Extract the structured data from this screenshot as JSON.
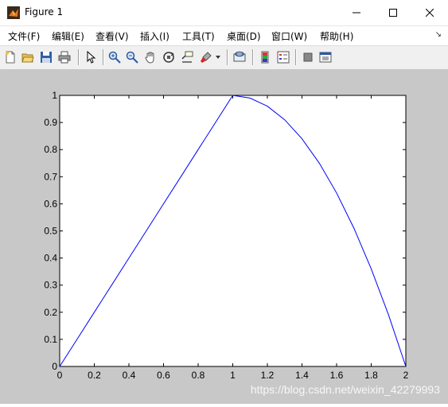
{
  "window": {
    "title": "Figure 1"
  },
  "menu": [
    "文件(F)",
    "编辑(E)",
    "查看(V)",
    "插入(I)",
    "工具(T)",
    "桌面(D)",
    "窗口(W)",
    "帮助(H)"
  ],
  "menu_overflow_icon": "chevron-double-down-icon",
  "toolbar": {
    "buttons": [
      "new-figure-icon",
      "open-file-icon",
      "save-icon",
      "print-icon",
      "edit-plot-arrow-icon",
      "zoom-in-icon",
      "zoom-out-icon",
      "pan-hand-icon",
      "rotate-3d-icon",
      "data-cursor-icon",
      "brush-icon",
      "insert-colorbar-icon",
      "insert-legend-icon",
      "hide-plot-tools-icon",
      "show-plot-tools-icon",
      "link-plot-icon"
    ]
  },
  "watermark": "https://blog.csdn.net/weixin_42279993",
  "colors": {
    "line": "#0000ff",
    "figure_bg": "#c8c8c8",
    "axes_bg": "#ffffff"
  },
  "chart_data": {
    "type": "line",
    "title": "",
    "xlabel": "",
    "ylabel": "",
    "xlim": [
      0,
      2
    ],
    "ylim": [
      0,
      1
    ],
    "xticks": [
      "0",
      "0.2",
      "0.4",
      "0.6",
      "0.8",
      "1",
      "1.2",
      "1.4",
      "1.6",
      "1.8",
      "2"
    ],
    "yticks": [
      "0",
      "0.1",
      "0.2",
      "0.3",
      "0.4",
      "0.5",
      "0.6",
      "0.7",
      "0.8",
      "0.9",
      "1"
    ],
    "grid": false,
    "series": [
      {
        "x": [
          0,
          0.1,
          0.2,
          0.3,
          0.4,
          0.5,
          0.6,
          0.7,
          0.8,
          0.9,
          1.0,
          1.1,
          1.2,
          1.3,
          1.4,
          1.5,
          1.6,
          1.7,
          1.8,
          1.9,
          2.0
        ],
        "y": [
          0,
          0.1,
          0.2,
          0.3,
          0.4,
          0.5,
          0.6,
          0.7,
          0.8,
          0.9,
          1.0,
          0.99,
          0.96,
          0.91,
          0.84,
          0.75,
          0.64,
          0.51,
          0.36,
          0.19,
          0
        ]
      }
    ]
  }
}
